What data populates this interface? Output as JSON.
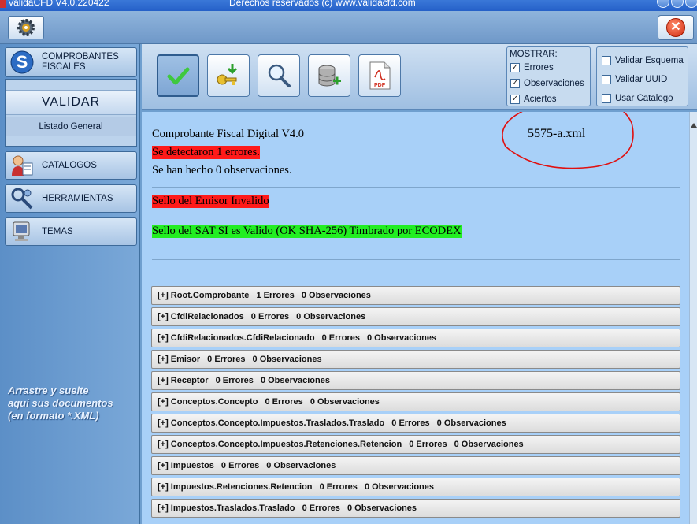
{
  "window": {
    "title": "ValidaCFD V4.0.220422",
    "copyright": "Derechos reservados (c) www.validacfd.com"
  },
  "sidebar": {
    "comprobantes_line1": "COMPROBANTES",
    "comprobantes_line2": "FISCALES",
    "validar": "VALIDAR",
    "listado": "Listado General",
    "catalogos": "CATALOGOS",
    "herramientas": "HERRAMIENTAS",
    "temas": "TEMAS",
    "drop_hint": [
      "Arrastre y suelte",
      "aqui sus documentos",
      "(en formato *.XML)"
    ]
  },
  "mostrar": {
    "title": "MOSTRAR:",
    "items": [
      {
        "label": "Errores",
        "checked": true
      },
      {
        "label": "Observaciones",
        "checked": true
      },
      {
        "label": "Aciertos",
        "checked": true
      }
    ]
  },
  "options": {
    "items": [
      {
        "label": "Validar Esquema",
        "checked": false
      },
      {
        "label": "Validar UUID",
        "checked": false
      },
      {
        "label": "Usar Catalogo",
        "checked": false
      }
    ]
  },
  "toolbar": {
    "pdf_label": "PDF"
  },
  "report": {
    "header": "Comprobante Fiscal Digital V4.0",
    "filename": "5575-a.xml",
    "errors_line": "Se detectaron 1 errores.",
    "observations_line": "Se han hecho 0 observaciones.",
    "sello_emisor": "Sello del Emisor Invalido",
    "sello_sat": "Sello del SAT SI es Valido (OK SHA-256) Timbrado por ECODEX"
  },
  "sections": [
    {
      "name": "[+] Root.Comprobante",
      "errors": "1 Errores",
      "obs": "0 Observaciones"
    },
    {
      "name": "[+] CfdiRelacionados",
      "errors": "0 Errores",
      "obs": "0 Observaciones"
    },
    {
      "name": "[+] CfdiRelacionados.CfdiRelacionado",
      "errors": "0 Errores",
      "obs": "0 Observaciones"
    },
    {
      "name": "[+] Emisor",
      "errors": "0 Errores",
      "obs": "0 Observaciones"
    },
    {
      "name": "[+] Receptor",
      "errors": "0 Errores",
      "obs": "0 Observaciones"
    },
    {
      "name": "[+] Conceptos.Concepto",
      "errors": "0 Errores",
      "obs": "0 Observaciones"
    },
    {
      "name": "[+] Conceptos.Concepto.Impuestos.Traslados.Traslado",
      "errors": "0 Errores",
      "obs": "0 Observaciones"
    },
    {
      "name": "[+] Conceptos.Concepto.Impuestos.Retenciones.Retencion",
      "errors": "0 Errores",
      "obs": "0 Observaciones"
    },
    {
      "name": "[+] Impuestos",
      "errors": "0 Errores",
      "obs": "0 Observaciones"
    },
    {
      "name": "[+] Impuestos.Retenciones.Retencion",
      "errors": "0 Errores",
      "obs": "0 Observaciones"
    },
    {
      "name": "[+] Impuestos.Traslados.Traslado",
      "errors": "0 Errores",
      "obs": "0 Observaciones"
    }
  ],
  "colors": {
    "error_highlight": "#ff1a1a",
    "ok_highlight": "#22ee22",
    "annotation": "#e01010"
  }
}
